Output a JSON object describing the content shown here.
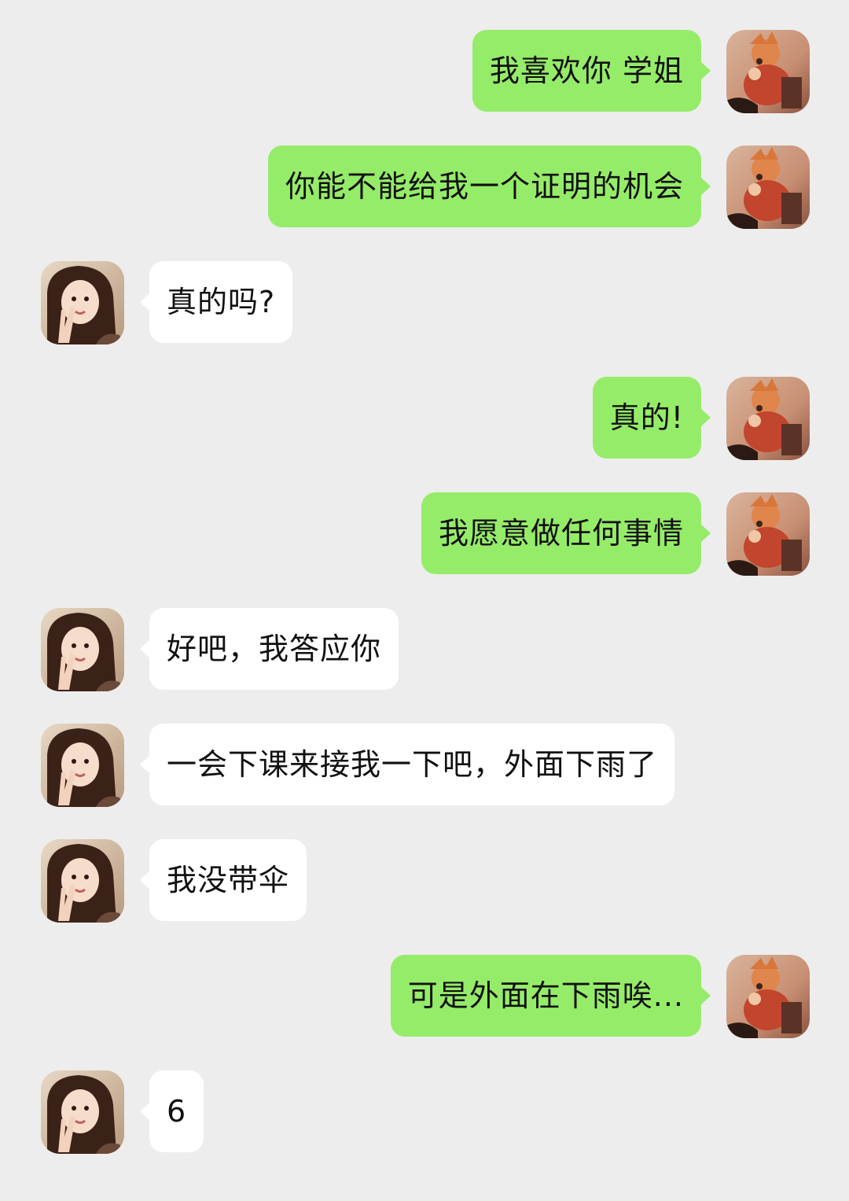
{
  "conversation": {
    "messages": [
      {
        "side": "right",
        "sender": "me",
        "text": "我喜欢你 学姐",
        "avatar_icon": "anime-boy-avatar-icon"
      },
      {
        "side": "right",
        "sender": "me",
        "text": "你能不能给我一个证明的机会",
        "avatar_icon": "anime-boy-avatar-icon"
      },
      {
        "side": "left",
        "sender": "other",
        "text": "真的吗?",
        "avatar_icon": "girl-peace-sign-avatar-icon"
      },
      {
        "side": "right",
        "sender": "me",
        "text": "真的!",
        "avatar_icon": "anime-boy-avatar-icon"
      },
      {
        "side": "right",
        "sender": "me",
        "text": "我愿意做任何事情",
        "avatar_icon": "anime-boy-avatar-icon"
      },
      {
        "side": "left",
        "sender": "other",
        "text": "好吧，我答应你",
        "avatar_icon": "girl-peace-sign-avatar-icon"
      },
      {
        "side": "left",
        "sender": "other",
        "text": "一会下课来接我一下吧，外面下雨了",
        "avatar_icon": "girl-peace-sign-avatar-icon"
      },
      {
        "side": "left",
        "sender": "other",
        "text": "我没带伞",
        "avatar_icon": "girl-peace-sign-avatar-icon"
      },
      {
        "side": "right",
        "sender": "me",
        "text": "可是外面在下雨唉...",
        "avatar_icon": "anime-boy-avatar-icon"
      },
      {
        "side": "left",
        "sender": "other",
        "text": "6",
        "avatar_icon": "girl-peace-sign-avatar-icon"
      }
    ]
  },
  "colors": {
    "background": "#ededed",
    "sent_bubble": "#95ec69",
    "received_bubble": "#ffffff",
    "text": "#111111"
  }
}
